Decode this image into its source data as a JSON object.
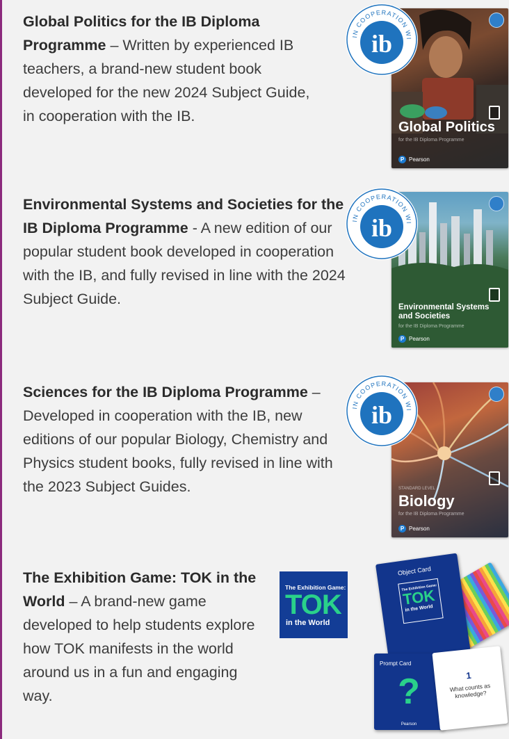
{
  "entries": [
    {
      "title": "Global Politics for the IB Diploma Programme",
      "body": " – Written by experienced IB teachers, a brand-new student book developed for the new 2024 Subject Guide, in cooperation with the IB."
    },
    {
      "title": "Environmental Systems and Societies for the IB Diploma Programme",
      "body": " - A new edition of our popular student book developed in cooperation with the IB, and fully revised in line with the 2024 Subject Guide."
    },
    {
      "title": "Sciences for the IB Diploma Programme",
      "body": " – Developed in cooperation with the IB, new editions of our popular Biology, Chemistry and Physics student books, fully revised in line with the 2023 Subject Guides."
    },
    {
      "title": "The Exhibition Game: TOK in the World",
      "body": " – A brand-new game developed to help students explore how TOK manifests in the world around us in a fun and engaging way."
    }
  ],
  "covers": [
    {
      "title": "Global Politics",
      "subtitle": "for the IB Diploma Programme",
      "publisher": "Pearson"
    },
    {
      "title_line1": "Environmental Systems",
      "title_line2": "and Societies",
      "subtitle": "for the IB Diploma Programme",
      "publisher": "Pearson"
    },
    {
      "level": "STANDARD LEVEL",
      "title": "Biology",
      "subtitle": "for the IB Diploma Programme",
      "publisher": "Pearson"
    }
  ],
  "ib_badge": {
    "ring_text": "IN COOPERATION WITH",
    "logo": "ib"
  },
  "game": {
    "cover_small": "The Exhibition Game:",
    "cover_big": "TOK",
    "cover_world": "in the World",
    "object_card": "Object Card",
    "object_small": "The Exhibition Game:",
    "object_big": "TOK",
    "object_world": "in the World",
    "prompt_card": "Prompt Card",
    "prompt_symbol": "?",
    "prompt_brand": "Pearson",
    "question_number": "1",
    "question_text": "What counts as knowledge?"
  },
  "colors": {
    "accent_rule": "#8b2a7d",
    "ib_blue": "#1f73be",
    "tok_blue": "#133d96",
    "tok_green": "#2ad18a"
  }
}
